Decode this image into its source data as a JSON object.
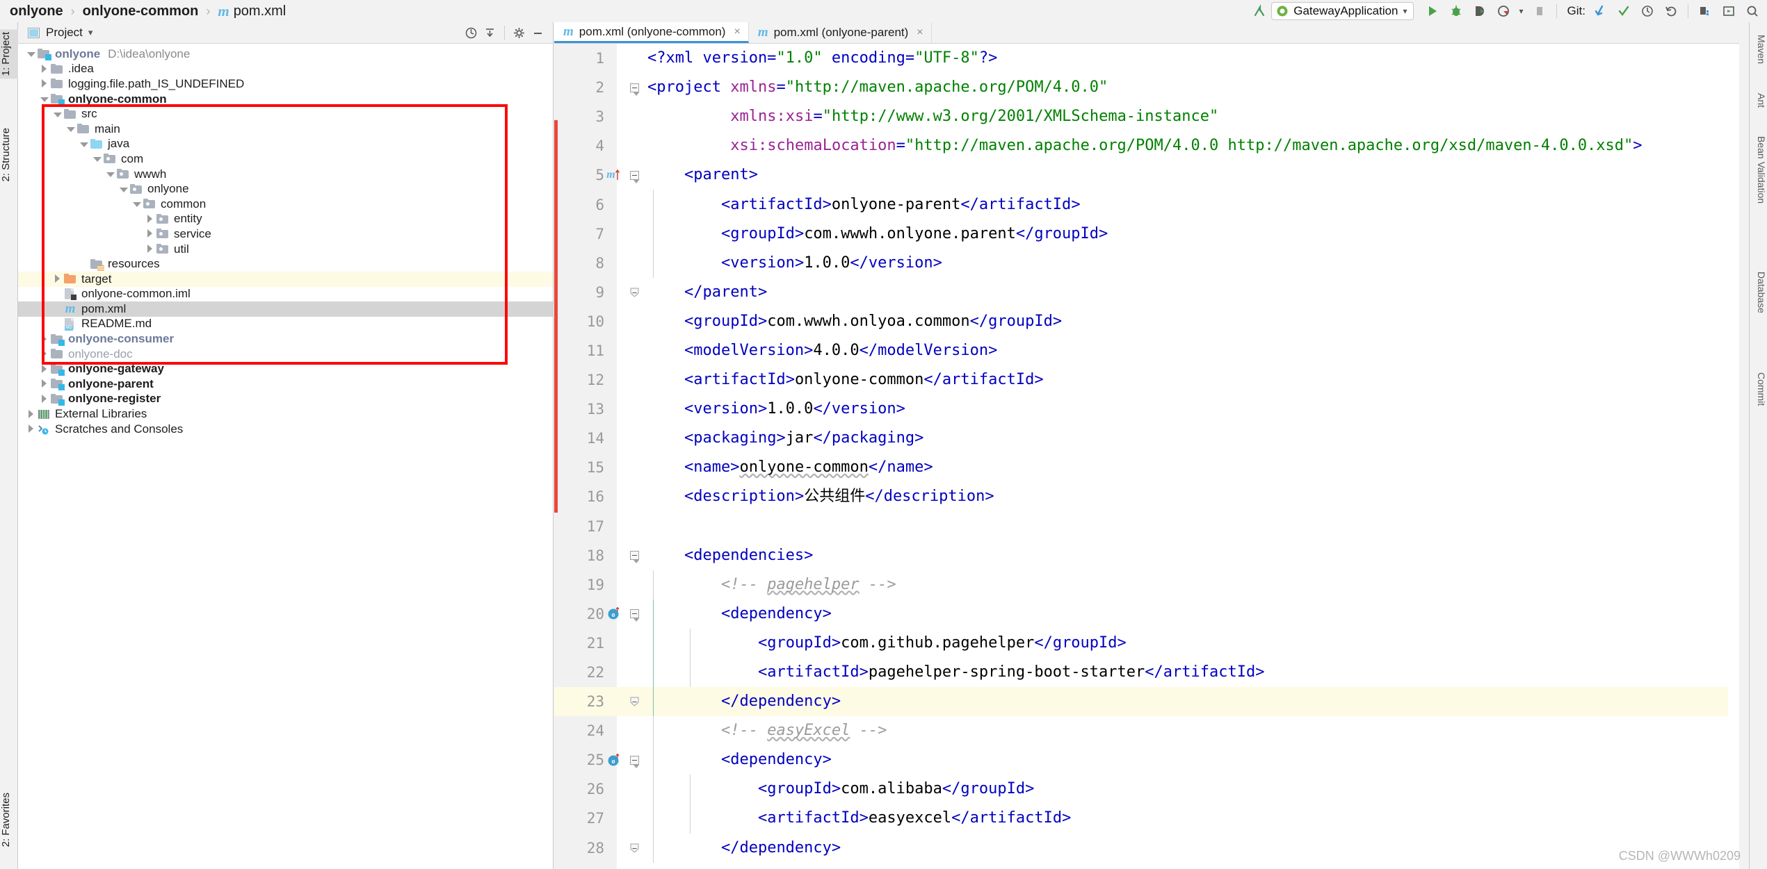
{
  "breadcrumb": {
    "items": [
      {
        "label": "onlyone",
        "bold": true,
        "icon": null
      },
      {
        "label": "onlyone-common",
        "bold": true,
        "icon": null
      },
      {
        "label": "pom.xml",
        "bold": false,
        "icon": "maven-m-icon"
      }
    ],
    "separator": "›"
  },
  "toolbar": {
    "back_arrow": "back-arrow-icon",
    "run_config_name": "GatewayApplication",
    "run_config_caret": "▾",
    "run_label": "run-icon",
    "debug_label": "debug-icon",
    "run_coverage_label": "run-with-coverage-icon",
    "profiler_label": "profiler-icon",
    "profiler_caret": "▾",
    "stop_label": "stop-icon",
    "git_label": "Git:",
    "git_update": "update-project-icon",
    "git_commit": "commit-icon",
    "git_history": "history-icon",
    "git_rollback": "rollback-icon",
    "structure_btn": "structure-icon",
    "preview_btn": "preview-icon",
    "search_btn": "search-icon"
  },
  "left_strip": {
    "tabs": [
      {
        "label": "1: Project",
        "active": true,
        "name": "tool-window-project"
      },
      {
        "label": "2: Structure",
        "active": false,
        "name": "tool-window-structure"
      },
      {
        "label": "2: Favorites",
        "active": false,
        "name": "tool-window-favorites"
      }
    ]
  },
  "right_strip": {
    "tabs": [
      {
        "label": "Maven",
        "name": "tool-window-maven"
      },
      {
        "label": "Ant",
        "name": "tool-window-ant"
      },
      {
        "label": "Bean Validation",
        "name": "tool-window-bean-validation"
      },
      {
        "label": "Database",
        "name": "tool-window-database"
      },
      {
        "label": "Commit",
        "name": "tool-window-commit"
      }
    ]
  },
  "project_panel": {
    "title": "Project",
    "title_caret": "▾",
    "header_buttons": [
      "locate-icon",
      "collapse-all-icon",
      "settings-gear-icon",
      "hide-icon"
    ],
    "tree": [
      {
        "indent": 0,
        "arrow": "down",
        "icon": "module-folder",
        "label": "onlyone",
        "style": "module-name",
        "path": "D:\\idea\\onlyone"
      },
      {
        "indent": 1,
        "arrow": "right",
        "icon": "folder",
        "label": ".idea",
        "style": "normal"
      },
      {
        "indent": 1,
        "arrow": "right",
        "icon": "folder",
        "label": "logging.file.path_IS_UNDEFINED",
        "style": "normal"
      },
      {
        "indent": 1,
        "arrow": "down",
        "icon": "module-folder",
        "label": "onlyone-common",
        "style": "bold"
      },
      {
        "indent": 2,
        "arrow": "down",
        "icon": "folder",
        "label": "src",
        "style": "normal"
      },
      {
        "indent": 3,
        "arrow": "down",
        "icon": "folder",
        "label": "main",
        "style": "normal"
      },
      {
        "indent": 4,
        "arrow": "down",
        "icon": "folder-blue",
        "label": "java",
        "style": "normal"
      },
      {
        "indent": 5,
        "arrow": "down",
        "icon": "package",
        "label": "com",
        "style": "normal"
      },
      {
        "indent": 6,
        "arrow": "down",
        "icon": "package",
        "label": "wwwh",
        "style": "normal"
      },
      {
        "indent": 7,
        "arrow": "down",
        "icon": "package",
        "label": "onlyone",
        "style": "normal"
      },
      {
        "indent": 8,
        "arrow": "down",
        "icon": "package",
        "label": "common",
        "style": "normal"
      },
      {
        "indent": 9,
        "arrow": "right",
        "icon": "package",
        "label": "entity",
        "style": "normal"
      },
      {
        "indent": 9,
        "arrow": "right",
        "icon": "package",
        "label": "service",
        "style": "normal"
      },
      {
        "indent": 9,
        "arrow": "right",
        "icon": "package",
        "label": "util",
        "style": "normal"
      },
      {
        "indent": 4,
        "arrow": "none",
        "icon": "resources",
        "label": "resources",
        "style": "normal"
      },
      {
        "indent": 2,
        "arrow": "right",
        "icon": "folder-orange",
        "label": "target",
        "style": "normal",
        "row_highlight": "target"
      },
      {
        "indent": 2,
        "arrow": "none",
        "icon": "iml-file",
        "label": "onlyone-common.iml",
        "style": "normal"
      },
      {
        "indent": 2,
        "arrow": "none",
        "icon": "maven-m-icon",
        "label": "pom.xml",
        "style": "normal",
        "selected": true
      },
      {
        "indent": 2,
        "arrow": "none",
        "icon": "md-file",
        "label": "README.md",
        "style": "normal"
      },
      {
        "indent": 1,
        "arrow": "right",
        "icon": "module-folder",
        "label": "onlyone-consumer",
        "style": "module-name"
      },
      {
        "indent": 1,
        "arrow": "right",
        "icon": "folder",
        "label": "onlyone-doc",
        "style": "muted"
      },
      {
        "indent": 1,
        "arrow": "right",
        "icon": "module-folder",
        "label": "onlyone-gateway",
        "style": "bold"
      },
      {
        "indent": 1,
        "arrow": "right",
        "icon": "module-folder",
        "label": "onlyone-parent",
        "style": "bold"
      },
      {
        "indent": 1,
        "arrow": "right",
        "icon": "module-folder",
        "label": "onlyone-register",
        "style": "bold"
      },
      {
        "indent": 0,
        "arrow": "right",
        "icon": "external-libraries-icon",
        "label": "External Libraries",
        "style": "normal"
      },
      {
        "indent": 0,
        "arrow": "right",
        "icon": "scratches-icon",
        "label": "Scratches and Consoles",
        "style": "normal"
      }
    ]
  },
  "editor": {
    "tabs": [
      {
        "label": "pom.xml (onlyone-common)",
        "icon": "maven-m-icon",
        "active": true,
        "close": "×"
      },
      {
        "label": "pom.xml (onlyone-parent)",
        "icon": "maven-m-icon",
        "active": false,
        "close": "×"
      }
    ],
    "lines": [
      {
        "num": "1",
        "gutter_m": false,
        "fold": "none",
        "indent_guides": 0,
        "text": "<?xml version=\"1.0\" encoding=\"UTF-8\"?>"
      },
      {
        "num": "2",
        "gutter_m": false,
        "fold": "open",
        "indent_guides": 0,
        "text": "<project xmlns=\"http://maven.apache.org/POM/4.0.0\""
      },
      {
        "num": "3",
        "gutter_m": false,
        "fold": "none",
        "indent_guides": 0,
        "text": "         xmlns:xsi=\"http://www.w3.org/2001/XMLSchema-instance\""
      },
      {
        "num": "4",
        "gutter_m": false,
        "fold": "none",
        "indent_guides": 0,
        "text": "         xsi:schemaLocation=\"http://maven.apache.org/POM/4.0.0 http://maven.apache.org/xsd/maven-4.0.0.xsd\">"
      },
      {
        "num": "5",
        "gutter_m": true,
        "fold": "open",
        "indent_guides": 0,
        "text": "    <parent>"
      },
      {
        "num": "6",
        "gutter_m": false,
        "fold": "none",
        "indent_guides": 1,
        "text": "        <artifactId>onlyone-parent</artifactId>"
      },
      {
        "num": "7",
        "gutter_m": false,
        "fold": "none",
        "indent_guides": 1,
        "text": "        <groupId>com.wwwh.onlyone.parent</groupId>"
      },
      {
        "num": "8",
        "gutter_m": false,
        "fold": "none",
        "indent_guides": 1,
        "text": "        <version>1.0.0</version>"
      },
      {
        "num": "9",
        "gutter_m": false,
        "fold": "close",
        "indent_guides": 0,
        "text": "    </parent>"
      },
      {
        "num": "10",
        "gutter_m": false,
        "fold": "none",
        "indent_guides": 0,
        "text": "    <groupId>com.wwwh.onlyoa.common</groupId>"
      },
      {
        "num": "11",
        "gutter_m": false,
        "fold": "none",
        "indent_guides": 0,
        "text": "    <modelVersion>4.0.0</modelVersion>"
      },
      {
        "num": "12",
        "gutter_m": false,
        "fold": "none",
        "indent_guides": 0,
        "text": "    <artifactId>onlyone-common</artifactId>"
      },
      {
        "num": "13",
        "gutter_m": false,
        "fold": "none",
        "indent_guides": 0,
        "text": "    <version>1.0.0</version>"
      },
      {
        "num": "14",
        "gutter_m": false,
        "fold": "none",
        "indent_guides": 0,
        "text": "    <packaging>jar</packaging>"
      },
      {
        "num": "15",
        "gutter_m": false,
        "fold": "none",
        "indent_guides": 0,
        "text": "    <name>onlyone-common</name>"
      },
      {
        "num": "16",
        "gutter_m": false,
        "fold": "none",
        "indent_guides": 0,
        "text": "    <description>公共组件</description>"
      },
      {
        "num": "17",
        "gutter_m": false,
        "fold": "none",
        "indent_guides": 0,
        "text": ""
      },
      {
        "num": "18",
        "gutter_m": false,
        "fold": "open",
        "indent_guides": 0,
        "text": "    <dependencies>"
      },
      {
        "num": "19",
        "gutter_m": false,
        "fold": "none",
        "indent_guides": 1,
        "text": "        <!-- pagehelper -->"
      },
      {
        "num": "20",
        "gutter_m": false,
        "gutter_dep": true,
        "fold": "open",
        "indent_guides": 1,
        "text": "        <dependency>"
      },
      {
        "num": "21",
        "gutter_m": false,
        "fold": "none",
        "indent_guides": 2,
        "text": "            <groupId>com.github.pagehelper</groupId>"
      },
      {
        "num": "22",
        "gutter_m": false,
        "fold": "none",
        "indent_guides": 2,
        "text": "            <artifactId>pagehelper-spring-boot-starter</artifactId>"
      },
      {
        "num": "23",
        "gutter_m": false,
        "fold": "close",
        "indent_guides": 1,
        "text": "        </dependency>",
        "row_highlight": true
      },
      {
        "num": "24",
        "gutter_m": false,
        "fold": "none",
        "indent_guides": 1,
        "text": "        <!-- easyExcel -->"
      },
      {
        "num": "25",
        "gutter_m": false,
        "gutter_dep": true,
        "fold": "open",
        "indent_guides": 1,
        "text": "        <dependency>"
      },
      {
        "num": "26",
        "gutter_m": false,
        "fold": "none",
        "indent_guides": 2,
        "text": "            <groupId>com.alibaba</groupId>"
      },
      {
        "num": "27",
        "gutter_m": false,
        "fold": "none",
        "indent_guides": 2,
        "text": "            <artifactId>easyexcel</artifactId>"
      },
      {
        "num": "28",
        "gutter_m": false,
        "fold": "close",
        "indent_guides": 1,
        "text": "        </dependency>"
      }
    ]
  },
  "watermark": "CSDN @WWWh0209"
}
